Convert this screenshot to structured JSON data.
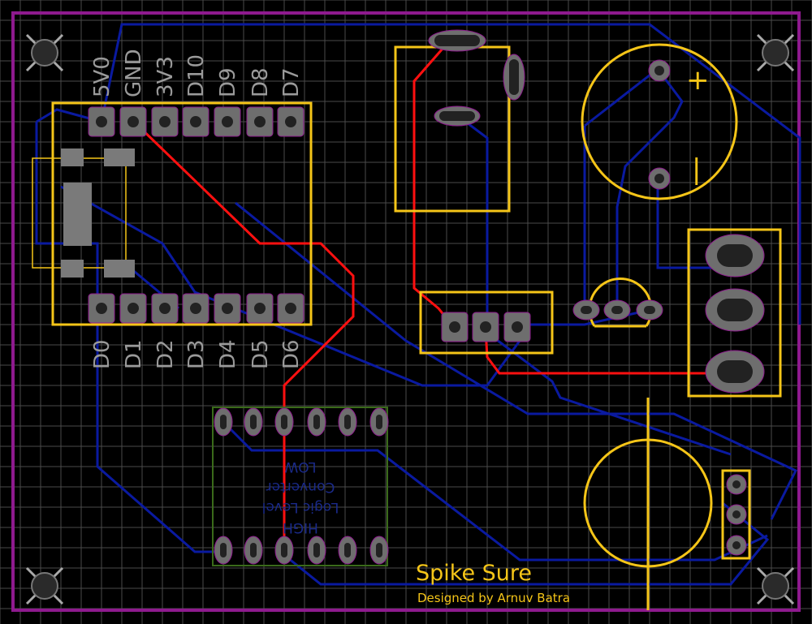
{
  "board": {
    "title": "Spike Sure",
    "credit": "Designed by Arnuv Batra",
    "colors": {
      "background": "#000000",
      "grid": "#5a5a5a",
      "outline": "#8e1a8e",
      "silkscreen": "#f5c518",
      "top_copper": "#ff1010",
      "bottom_copper": "#0a1aa0",
      "pad": "#6e6e6e",
      "hole": "#222222"
    }
  },
  "microcontroller": {
    "top_pins": [
      "5V0",
      "GND",
      "3V3",
      "D10",
      "D9",
      "D8",
      "D7"
    ],
    "bottom_pins": [
      "D0",
      "D1",
      "D2",
      "D3",
      "D4",
      "D5",
      "D6"
    ]
  },
  "level_shifter": {
    "lines": [
      "HIGH",
      "Logic Level",
      "Converter",
      "LOW"
    ]
  },
  "capacitor": {
    "plus": "+",
    "minus": "|"
  },
  "icons": [
    "mounting-hole-icon",
    "pin-pad-icon",
    "oval-pad-icon",
    "via-icon"
  ]
}
